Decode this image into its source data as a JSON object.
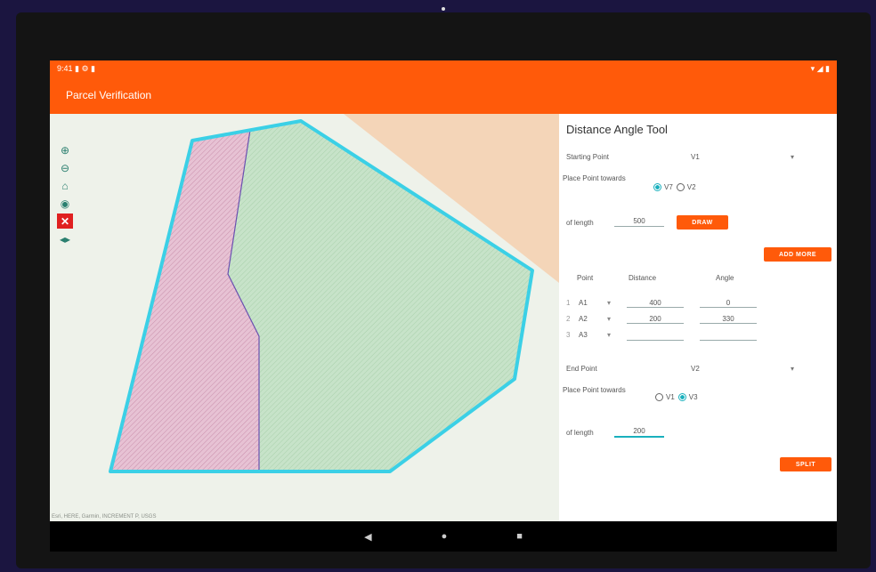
{
  "status_bar": {
    "left": "9:41 ▮ ⚙ ▮",
    "right": "▾ ◢ ▮"
  },
  "app_title": "Parcel Verification",
  "map": {
    "attribution": "Esri, HERE, Garmin, INCREMENT P, USGS",
    "tools": [
      "zoom-in-icon",
      "zoom-out-icon",
      "home-icon",
      "locate-icon",
      "close-icon",
      "swipe-icon"
    ]
  },
  "panel": {
    "title": "Distance Angle Tool",
    "starting_point_label": "Starting Point",
    "starting_point_value": "V1",
    "place_towards_label": "Place Point towards",
    "start_radio": [
      {
        "label": "V7",
        "checked": true
      },
      {
        "label": "V2",
        "checked": false
      }
    ],
    "length_label": "of length",
    "length_value": "500",
    "draw_button": "DRAW",
    "add_more_button": "ADD MORE",
    "table": {
      "headers": [
        "Point",
        "Distance",
        "Angle"
      ],
      "rows": [
        {
          "idx": "1",
          "point": "A1",
          "distance": "400",
          "angle": "0"
        },
        {
          "idx": "2",
          "point": "A2",
          "distance": "200",
          "angle": "330"
        },
        {
          "idx": "3",
          "point": "A3",
          "distance": "",
          "angle": ""
        }
      ]
    },
    "end_point_label": "End Point",
    "end_point_value": "V2",
    "end_place_towards_label": "Place Point towards",
    "end_radio": [
      {
        "label": "V1",
        "checked": false
      },
      {
        "label": "V3",
        "checked": true
      }
    ],
    "end_length_label": "of length",
    "end_length_value": "200",
    "split_button": "SPLIT"
  },
  "nav": {
    "back": "◀",
    "home": "●",
    "recents": "■"
  },
  "colors": {
    "accent": "#ff5a0a",
    "parcel_outline": "#3bd0e6",
    "left_parcel": "#e7c2d4",
    "right_parcel": "#c7e3c9",
    "terrain": "#f4d5b8"
  }
}
